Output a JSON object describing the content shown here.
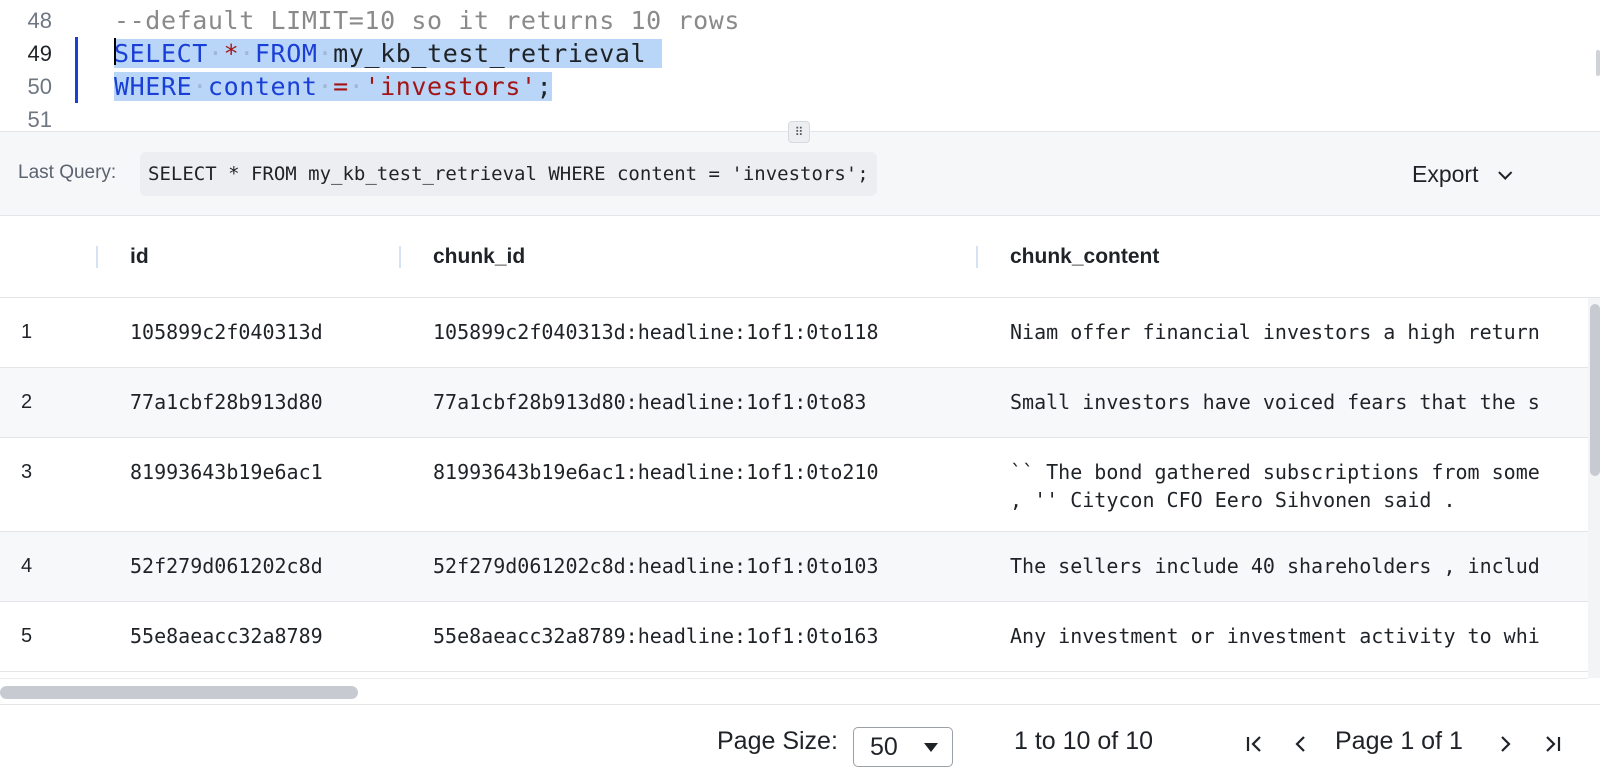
{
  "editor": {
    "lines": [
      {
        "num": "48",
        "text": "--default LIMIT=10 so it returns 10 rows"
      },
      {
        "num": "49",
        "text": "SELECT * FROM my_kb_test_retrieval"
      },
      {
        "num": "50",
        "text": "WHERE content = 'investors';"
      },
      {
        "num": "51",
        "text": ""
      }
    ],
    "tokens": {
      "select": "SELECT",
      "star": "*",
      "from": "FROM",
      "table": "my_kb_test_retrieval",
      "where": "WHERE",
      "content": "content",
      "eq": "=",
      "string": "'investors'",
      "semi": ";"
    },
    "resize_handle_icon": "drag-handle-icon"
  },
  "query_bar": {
    "label": "Last Query:",
    "query": "SELECT * FROM my_kb_test_retrieval WHERE content = 'investors';",
    "export_label": "Export",
    "export_icon": "chevron-down-icon"
  },
  "grid": {
    "columns": [
      "id",
      "chunk_id",
      "chunk_content"
    ],
    "rows": [
      {
        "n": "1",
        "id": "105899c2f040313d",
        "chunk_id": "105899c2f040313d:headline:1of1:0to118",
        "content_1": "Niam offer financial investors a high return",
        "content_2": ""
      },
      {
        "n": "2",
        "id": "77a1cbf28b913d80",
        "chunk_id": "77a1cbf28b913d80:headline:1of1:0to83",
        "content_1": "Small investors have voiced fears that the s",
        "content_2": ""
      },
      {
        "n": "3",
        "id": "81993643b19e6ac1",
        "chunk_id": "81993643b19e6ac1:headline:1of1:0to210",
        "content_1": "`` The bond gathered subscriptions from some",
        "content_2": ", '' Citycon CFO Eero Sihvonen said ."
      },
      {
        "n": "4",
        "id": "52f279d061202c8d",
        "chunk_id": "52f279d061202c8d:headline:1of1:0to103",
        "content_1": "The sellers include 40 shareholders , includ",
        "content_2": ""
      },
      {
        "n": "5",
        "id": "55e8aeacc32a8789",
        "chunk_id": "55e8aeacc32a8789:headline:1of1:0to163",
        "content_1": "Any investment or investment activity to whi",
        "content_2": ""
      }
    ]
  },
  "pagination": {
    "page_size_label": "Page Size:",
    "page_size_value": "50",
    "range_text": "1 to 10 of 10",
    "page_text": "Page 1 of 1",
    "icons": [
      "first-page-icon",
      "prev-page-icon",
      "next-page-icon",
      "last-page-icon"
    ]
  },
  "colors": {
    "keyword": "#1a3fd6",
    "string": "#a31515",
    "selection": "#b9d6f8",
    "comment": "#8a8a8a"
  }
}
